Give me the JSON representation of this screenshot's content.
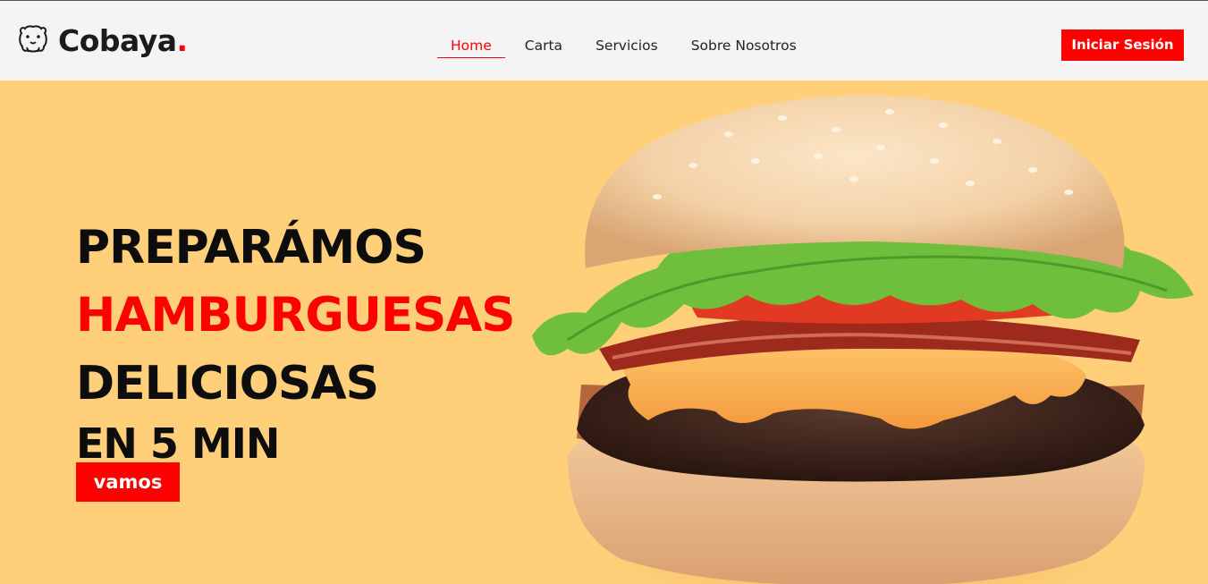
{
  "brand": {
    "name": "Cobaya",
    "dot": ".",
    "logo_icon": "guinea-pig-icon"
  },
  "nav": {
    "items": [
      {
        "label": "Home",
        "active": true
      },
      {
        "label": "Carta",
        "active": false
      },
      {
        "label": "Servicios",
        "active": false
      },
      {
        "label": "Sobre Nosotros",
        "active": false
      }
    ]
  },
  "header": {
    "login_label": "Iniciar Sesión"
  },
  "hero": {
    "line1": "PREPARÁMOS",
    "line2": "HAMBURGUESAS",
    "line3": "DELICIOSAS",
    "line4": "EN 5 MIN",
    "cta_label": "vamos",
    "image": "hamburger-photo"
  },
  "colors": {
    "accent": "#ff0000",
    "hero_bg": "#ffcf7a",
    "header_bg": "#f4f4f4",
    "text": "#0d0d0d"
  }
}
